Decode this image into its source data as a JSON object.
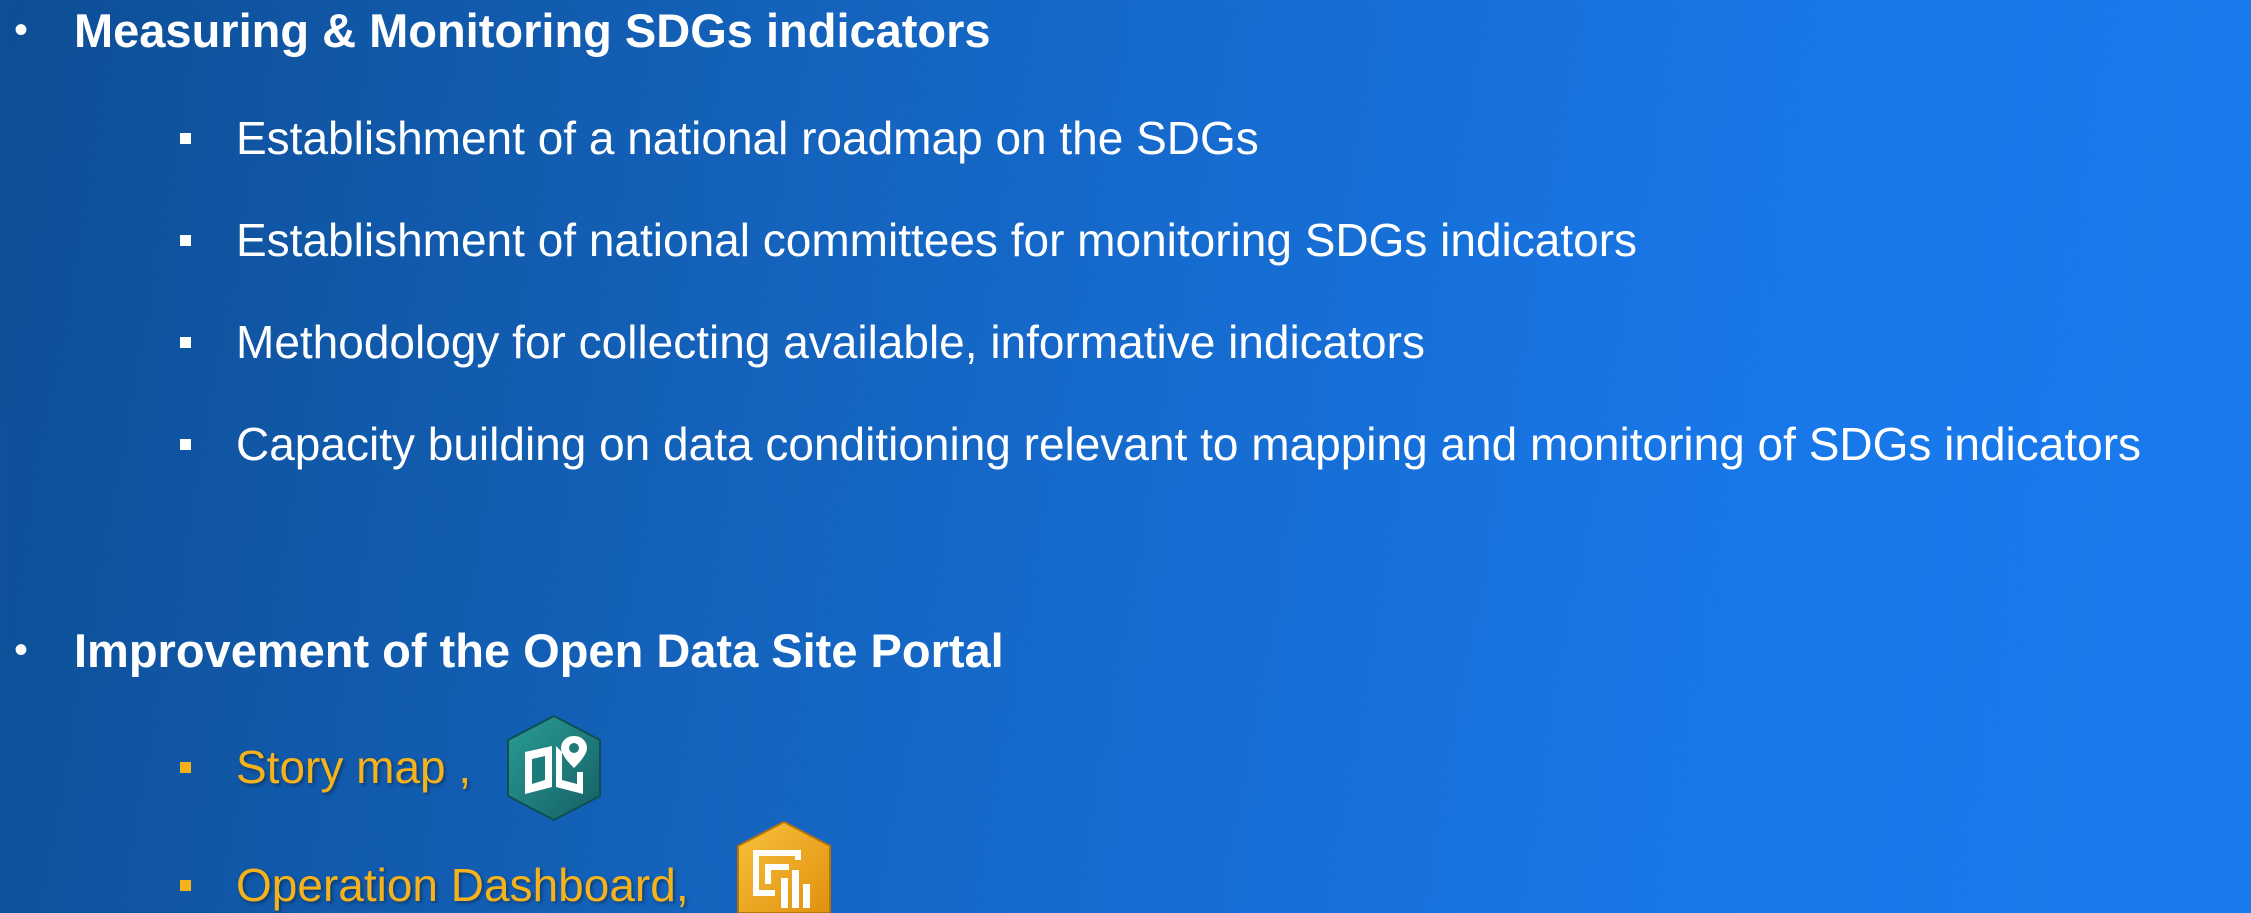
{
  "section1": {
    "bullet": "•",
    "title": "Measuring & Monitoring SDGs indicators",
    "items": [
      "Establishment of a national roadmap on the SDGs",
      "Establishment of national committees for monitoring SDGs indicators",
      "Methodology for collecting available, informative indicators",
      "Capacity building on data conditioning relevant to mapping and monitoring of SDGs indicators"
    ]
  },
  "section2": {
    "bullet": "•",
    "title": "Improvement of the Open Data Site Portal",
    "items": [
      {
        "label": "Story map ,",
        "icon": "story-map-icon"
      },
      {
        "label": "Operation Dashboard,",
        "icon": "operations-dashboard-icon"
      }
    ]
  },
  "colors": {
    "text": "#ffffff",
    "highlight": "#f5b21b",
    "story_map_icon": "#1d7b7b",
    "dashboard_icon": "#f0a81c"
  }
}
